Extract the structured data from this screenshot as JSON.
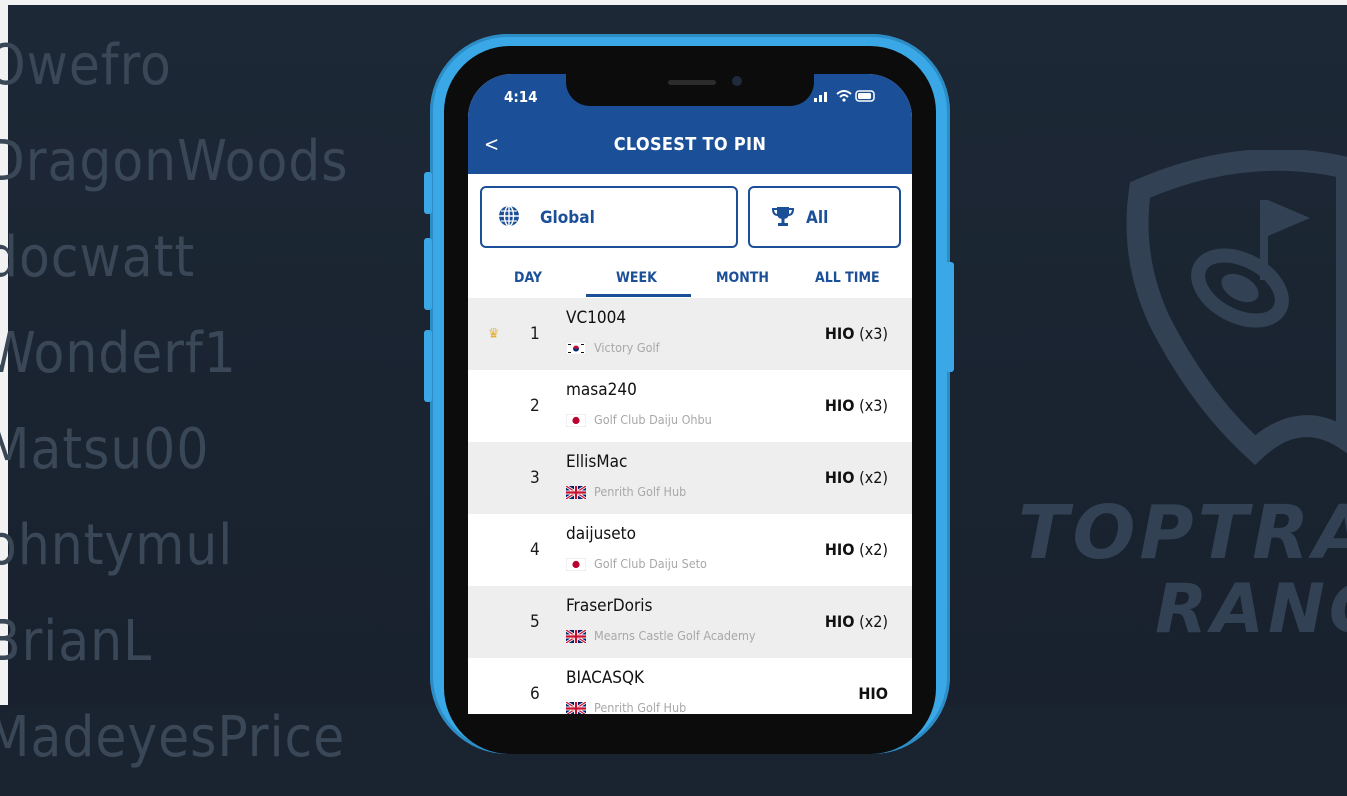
{
  "background": {
    "names": [
      "Owefro",
      "DragonWoods",
      "docwatt",
      "Wonderf1",
      "Matsu00",
      "ohntymul",
      "BrianL",
      "MadeyesPrice"
    ],
    "logo_line1": "TOPTRA",
    "logo_line2": "RANG"
  },
  "status_bar": {
    "time": "4:14",
    "icons": "signal-wifi-battery"
  },
  "header": {
    "back": "<",
    "title": "CLOSEST TO PIN"
  },
  "filters": {
    "region": "Global",
    "region_icon": "globe-icon",
    "category": "All",
    "category_icon": "trophy-icon"
  },
  "tabs": {
    "day": "DAY",
    "week": "WEEK",
    "month": "MONTH",
    "all_time": "ALL TIME",
    "selected": "WEEK"
  },
  "leaderboard": [
    {
      "rank": "1",
      "name": "VC1004",
      "country": "KR",
      "club": "Victory Golf",
      "score_main": "HIO",
      "score_mult": "(x3)",
      "crown": true
    },
    {
      "rank": "2",
      "name": "masa240",
      "country": "JP",
      "club": "Golf Club Daiju Ohbu",
      "score_main": "HIO",
      "score_mult": "(x3)",
      "crown": false
    },
    {
      "rank": "3",
      "name": "EllisMac",
      "country": "GB",
      "club": "Penrith Golf Hub",
      "score_main": "HIO",
      "score_mult": "(x2)",
      "crown": false
    },
    {
      "rank": "4",
      "name": "daijuseto",
      "country": "JP",
      "club": "Golf Club Daiju Seto",
      "score_main": "HIO",
      "score_mult": "(x2)",
      "crown": false
    },
    {
      "rank": "5",
      "name": "FraserDoris",
      "country": "GB",
      "club": "Mearns Castle Golf Academy",
      "score_main": "HIO",
      "score_mult": "(x2)",
      "crown": false
    },
    {
      "rank": "6",
      "name": "BIACASQK",
      "country": "GB",
      "club": "Penrith Golf Hub",
      "score_main": "HIO",
      "score_mult": "",
      "crown": false
    }
  ],
  "colors": {
    "brand_blue": "#1b4f97",
    "phone_blue": "#3aa8e6",
    "crown": "#e8b030"
  }
}
